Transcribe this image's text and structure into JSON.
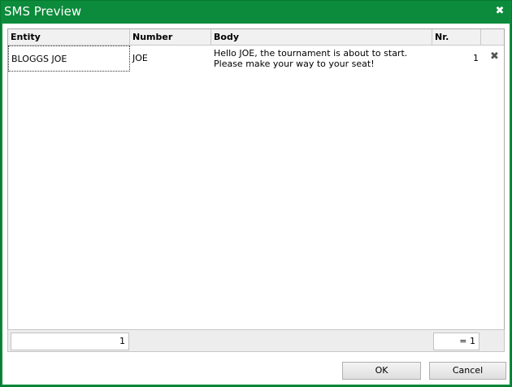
{
  "window": {
    "title": "SMS Preview",
    "close_glyph": "✖"
  },
  "grid": {
    "columns": [
      "Entity",
      "Number",
      "Body",
      "Nr."
    ],
    "rows": [
      {
        "entity": "BLOGGS JOE",
        "number": "JOE",
        "body": "Hello JOE, the tournament is about to start. Please make your way to your seat!",
        "nr": "1",
        "delete_glyph": "✖"
      }
    ]
  },
  "footer": {
    "left_summary": "1",
    "right_summary": "= 1"
  },
  "buttons": {
    "ok": "OK",
    "cancel": "Cancel"
  },
  "colors": {
    "frame": "#0a8a3a",
    "title_text": "#ffffff"
  },
  "icons": {
    "close": "close-icon",
    "delete_row": "delete-row-icon"
  }
}
